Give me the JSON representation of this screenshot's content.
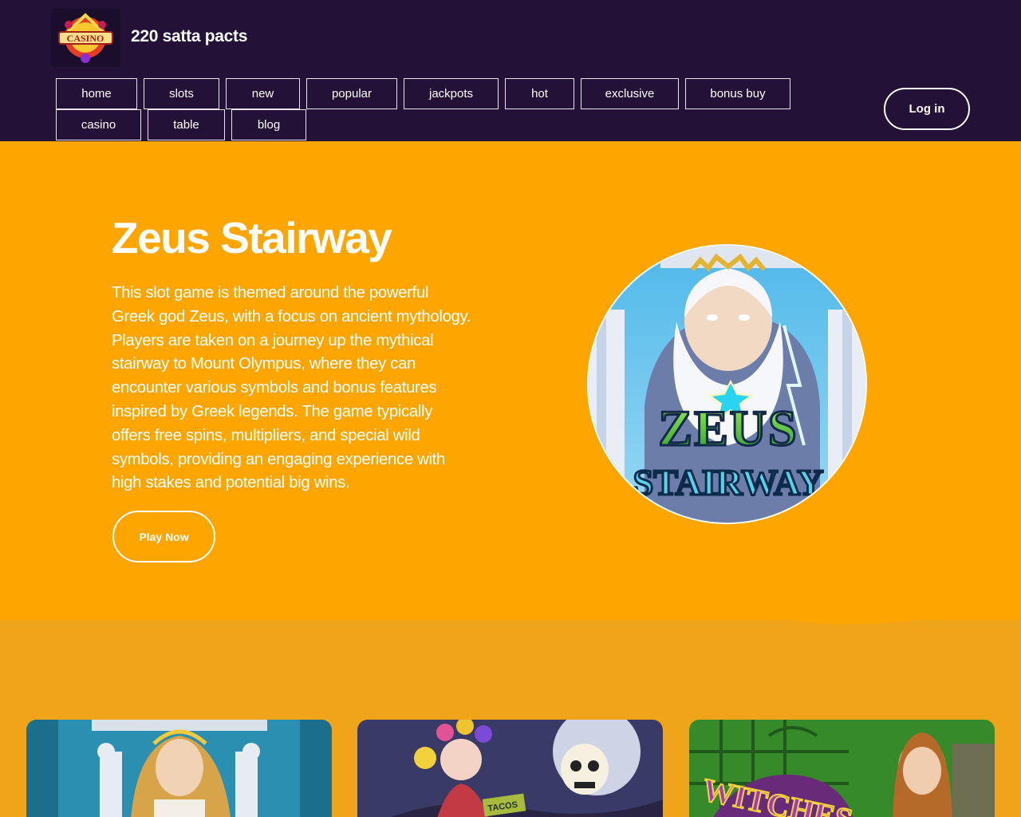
{
  "site": {
    "title": "220 satta pacts",
    "logo_text": "CASINO"
  },
  "nav": {
    "items": [
      {
        "label": "home"
      },
      {
        "label": "slots"
      },
      {
        "label": "new"
      },
      {
        "label": "popular"
      },
      {
        "label": "jackpots"
      },
      {
        "label": "hot"
      },
      {
        "label": "exclusive"
      },
      {
        "label": "bonus buy"
      },
      {
        "label": "casino"
      },
      {
        "label": "table"
      },
      {
        "label": "blog"
      }
    ],
    "login_label": "Log in"
  },
  "hero": {
    "title": "Zeus Stairway",
    "description": "This slot game is themed around the powerful Greek god Zeus, with a focus on ancient mythology. Players are taken on a journey up the mythical stairway to Mount Olympus, where they can encounter various symbols and bonus features inspired by Greek legends. The game typically offers free spins, multipliers, and special wild symbols, providing an engaging experience with high stakes and potential big wins.",
    "play_label": "Play Now",
    "image_logo_line1": "ZEUS",
    "image_logo_line2": "STAIRWAY"
  },
  "cards": {
    "card2_sign": "TACOS",
    "card3_title": "WITCHES"
  },
  "colors": {
    "header_bg": "#231137",
    "hero_bg": "#ffa500",
    "section_bg": "#f0a419"
  }
}
